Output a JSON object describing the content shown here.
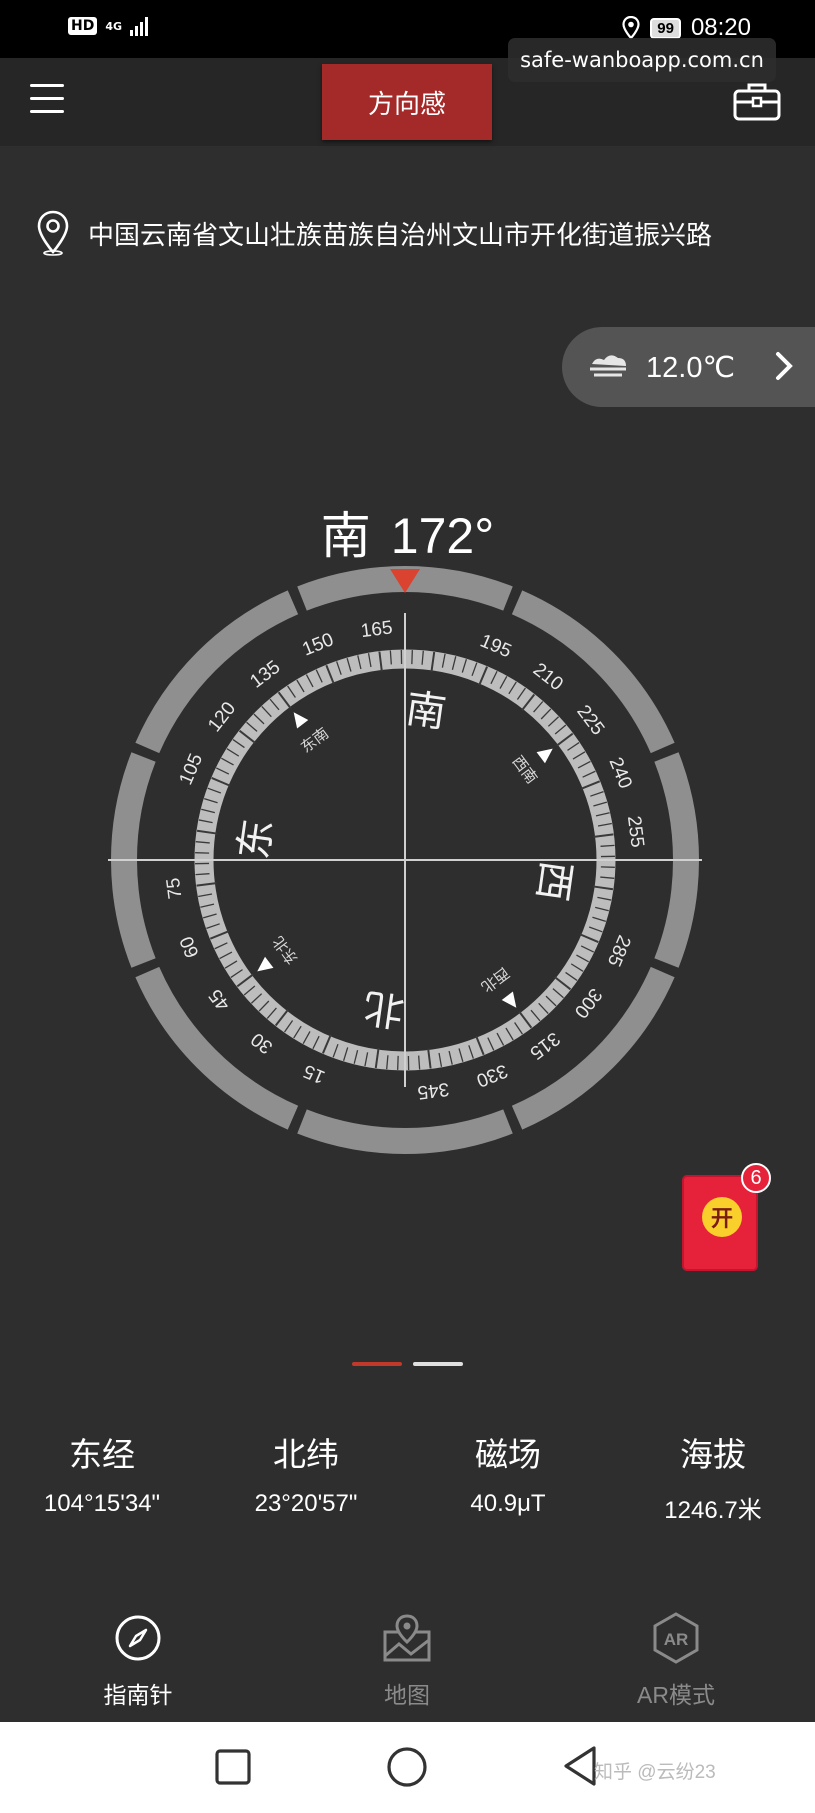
{
  "status_bar": {
    "hd_label": "HD",
    "network_label": "4G",
    "battery_level": "99",
    "time": "08:20"
  },
  "header": {
    "title": "方向感",
    "watermark_url": "safe-wanboapp.com.cn"
  },
  "location": {
    "address": "中国云南省文山壮族苗族自治州文山市开化街道振兴路"
  },
  "weather": {
    "temperature": "12.0℃"
  },
  "heading": {
    "direction": "南",
    "degrees": "172°"
  },
  "compass": {
    "heading_deg": 172,
    "tick_labels": [
      "15",
      "30",
      "45",
      "60",
      "75",
      "105",
      "120",
      "135",
      "150",
      "165",
      "195",
      "210",
      "225",
      "240",
      "255",
      "285",
      "300",
      "315",
      "330",
      "345"
    ],
    "cardinals": {
      "north": "北",
      "east": "东",
      "south": "南",
      "west": "西"
    },
    "intercardinals": {
      "northeast": "东北",
      "southeast": "东南",
      "southwest": "西南",
      "northwest": "西北"
    },
    "colors": {
      "pointer": "#d9432f",
      "ring": "#8f8f8f",
      "tick_band": "#bdbdbd"
    }
  },
  "red_packet": {
    "label": "开",
    "badge_count": "6"
  },
  "stats": [
    {
      "label": "东经",
      "value": "104°15'34\""
    },
    {
      "label": "北纬",
      "value": "23°20'57\""
    },
    {
      "label": "磁场",
      "value": "40.9μT"
    },
    {
      "label": "海拔",
      "value": "1246.7米"
    }
  ],
  "bottom_nav": {
    "items": [
      {
        "label": "指南针",
        "icon": "compass-icon",
        "active": true
      },
      {
        "label": "地图",
        "icon": "map-icon",
        "active": false
      },
      {
        "label": "AR模式",
        "icon": "ar-icon",
        "active": false
      }
    ],
    "ar_icon_text": "AR"
  },
  "system_nav": {
    "watermark": "知乎 @云纷23"
  }
}
